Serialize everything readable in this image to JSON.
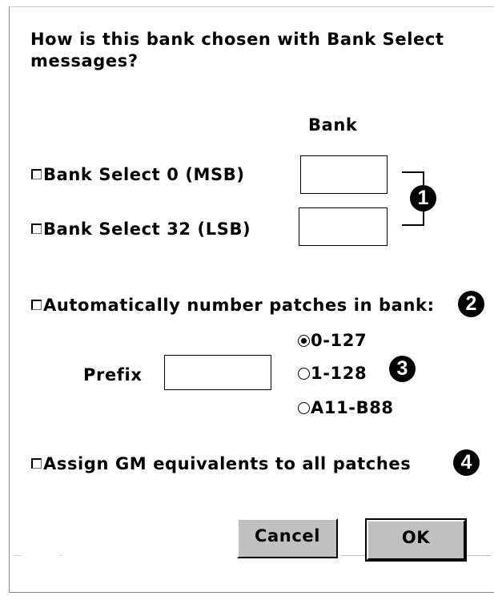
{
  "dialog": {
    "question": "How is this bank chosen with Bank Select messages?",
    "bank_header": "Bank",
    "bank_select_msb": {
      "label": "Bank Select 0 (MSB)",
      "checked": false,
      "value": ""
    },
    "bank_select_lsb": {
      "label": "Bank Select 32 (LSB)",
      "checked": false,
      "value": ""
    },
    "auto_number": {
      "label": "Automatically number patches in bank:",
      "checked": false
    },
    "prefix": {
      "label": "Prefix",
      "value": ""
    },
    "numbering_options": [
      {
        "label": "0-127",
        "selected": true
      },
      {
        "label": "1-128",
        "selected": false
      },
      {
        "label": "A11-B88",
        "selected": false
      }
    ],
    "assign_gm": {
      "label": "Assign GM equivalents to all patches",
      "checked": false
    },
    "buttons": {
      "cancel": "Cancel",
      "ok": "OK"
    }
  },
  "callouts": [
    "1",
    "2",
    "3",
    "4"
  ]
}
